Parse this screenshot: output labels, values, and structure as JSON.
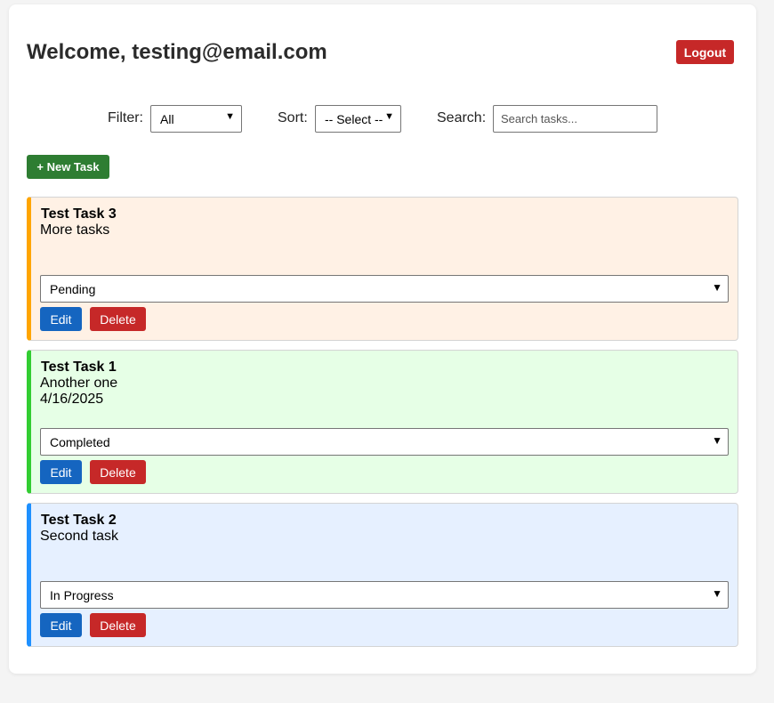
{
  "header": {
    "title": "Welcome, testing@email.com",
    "logout_label": "Logout"
  },
  "controls": {
    "filter_label": "Filter:",
    "filter_value": "All",
    "sort_label": "Sort:",
    "sort_value": "-- Select --",
    "search_label": "Search:",
    "search_placeholder": "Search tasks...",
    "search_value": ""
  },
  "new_task_label": "+ New Task",
  "icons": {
    "chevron": "chevron-down-icon"
  },
  "colors": {
    "pending_bg": "#fff1e5",
    "pending_accent": "#ffa500",
    "completed_bg": "#e6ffe6",
    "completed_accent": "#32cd32",
    "in_progress_bg": "#e6f0ff",
    "in_progress_accent": "#1e90ff",
    "logout": "#c62828",
    "new_task": "#2e7d32",
    "edit": "#1565c0",
    "delete": "#c62828"
  },
  "tasks": [
    {
      "title": "Test Task 3",
      "description": "More tasks",
      "date": "",
      "status": "Pending",
      "edit_label": "Edit",
      "delete_label": "Delete"
    },
    {
      "title": "Test Task 1",
      "description": "Another one",
      "date": "4/16/2025",
      "status": "Completed",
      "edit_label": "Edit",
      "delete_label": "Delete"
    },
    {
      "title": "Test Task 2",
      "description": "Second task",
      "date": "",
      "status": "In Progress",
      "edit_label": "Edit",
      "delete_label": "Delete"
    }
  ]
}
